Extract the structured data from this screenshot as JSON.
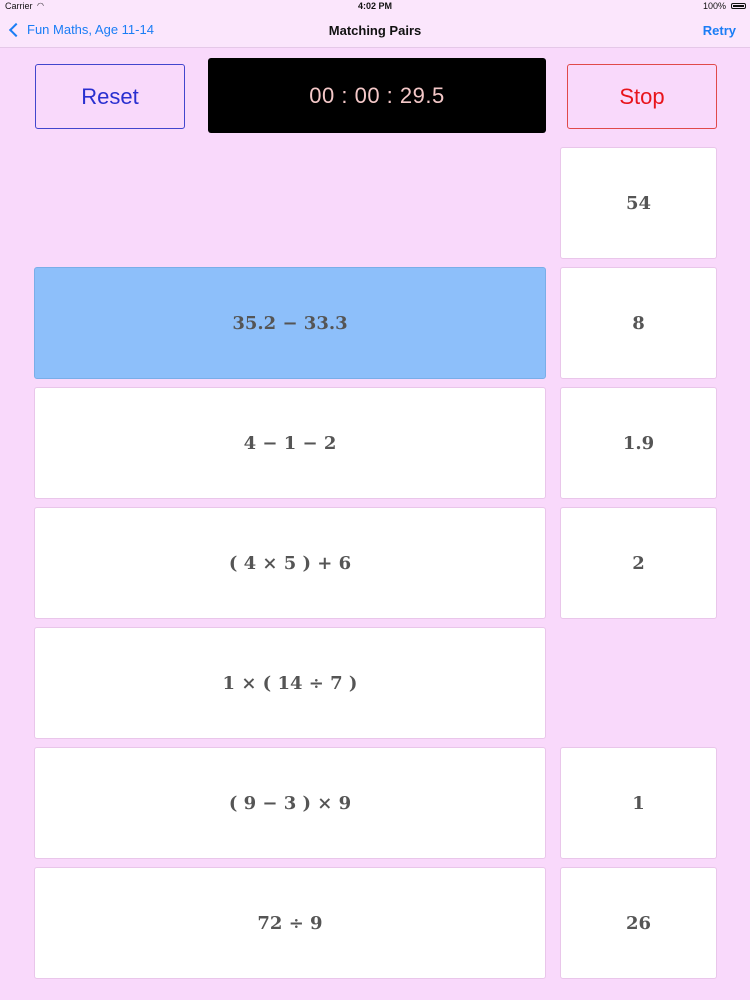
{
  "status_bar": {
    "carrier": "Carrier",
    "time": "4:02 PM",
    "battery": "100%"
  },
  "nav": {
    "back_label": "Fun Maths, Age 11-14",
    "title": "Matching Pairs",
    "retry_label": "Retry"
  },
  "controls": {
    "reset_label": "Reset",
    "timer": "00 : 00 : 29.5",
    "stop_label": "Stop"
  },
  "colors": {
    "background": "#f9d9fb",
    "selected_card": "#8dbffa",
    "reset": "#2a2fd0",
    "stop": "#e8141c",
    "link": "#1a7df5"
  },
  "questions": [
    {
      "text": "",
      "state": "matched"
    },
    {
      "text": "35.2 − 33.3",
      "state": "selected"
    },
    {
      "text": "4 − 1 − 2",
      "state": "normal"
    },
    {
      "text": "( 4 × 5 ) + 6",
      "state": "normal"
    },
    {
      "text": "1 × ( 14 ÷ 7 )",
      "state": "normal"
    },
    {
      "text": "( 9 − 3 ) × 9",
      "state": "normal"
    },
    {
      "text": "72 ÷ 9",
      "state": "normal"
    }
  ],
  "answers": [
    {
      "text": "54",
      "state": "normal"
    },
    {
      "text": "8",
      "state": "normal"
    },
    {
      "text": "1.9",
      "state": "normal"
    },
    {
      "text": "2",
      "state": "normal"
    },
    {
      "text": "",
      "state": "matched"
    },
    {
      "text": "1",
      "state": "normal"
    },
    {
      "text": "26",
      "state": "normal"
    }
  ]
}
